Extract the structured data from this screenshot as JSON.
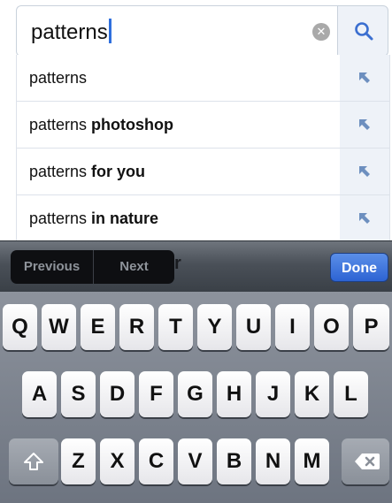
{
  "search": {
    "value": "patterns",
    "clear_icon": "clear-x-icon",
    "search_icon": "magnifier-icon"
  },
  "suggestions": [
    {
      "prefix": "patterns",
      "suffix": ""
    },
    {
      "prefix": "patterns ",
      "suffix": "photoshop"
    },
    {
      "prefix": "patterns ",
      "suffix": "for you"
    },
    {
      "prefix": "patterns ",
      "suffix": "in nature"
    }
  ],
  "toolbar": {
    "previous_label": "Previous",
    "next_label": "Next",
    "obscured_text": "r",
    "done_label": "Done"
  },
  "keyboard": {
    "row1": [
      "Q",
      "W",
      "E",
      "R",
      "T",
      "Y",
      "U",
      "I",
      "O",
      "P"
    ],
    "row2": [
      "A",
      "S",
      "D",
      "F",
      "G",
      "H",
      "J",
      "K",
      "L"
    ],
    "row3": [
      "Z",
      "X",
      "C",
      "V",
      "B",
      "N",
      "M"
    ],
    "shift_icon": "shift-arrow-icon",
    "delete_icon": "backspace-icon"
  },
  "colors": {
    "accent": "#2d63d3",
    "caret": "#2f6fdd"
  }
}
